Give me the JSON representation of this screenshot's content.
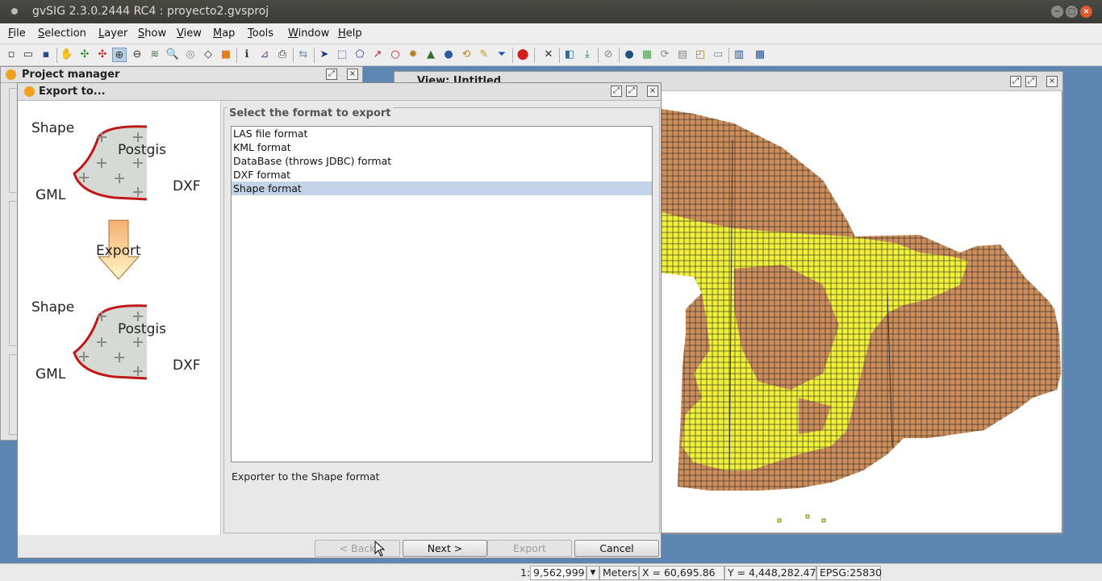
{
  "window": {
    "title": "gvSIG 2.3.0.2444 RC4 : proyecto2.gvsproj"
  },
  "menu": [
    "File",
    "Selection",
    "Layer",
    "Show",
    "View",
    "Map",
    "Tools",
    "Window",
    "Help"
  ],
  "project_manager": {
    "title": "Project manager"
  },
  "view_window": {
    "title": "View: Untitled"
  },
  "dialog": {
    "title": "Export to...",
    "illustration": {
      "top": {
        "shape": "Shape",
        "postgis": "Postgis",
        "gml": "GML",
        "dxf": "DXF"
      },
      "arrow_label": "Export",
      "bottom": {
        "shape": "Shape",
        "postgis": "Postgis",
        "gml": "GML",
        "dxf": "DXF"
      }
    },
    "group_title": "Select the format to export",
    "formats": [
      "LAS file format",
      "KML format",
      "DataBase (throws JDBC) format",
      "DXF format",
      "Shape format"
    ],
    "selected_format": "Shape format",
    "description": "Exporter to the Shape format",
    "buttons": {
      "back": "< Back",
      "next": "Next >",
      "export": "Export",
      "cancel": "Cancel"
    }
  },
  "status": {
    "scale_prefix": "1:",
    "scale": "9,562,999",
    "units": "Meters",
    "x": "X = 60,695.86",
    "y": "Y = 4,448,282.47",
    "crs": "EPSG:25830"
  },
  "colors": {
    "map_brown": "#cc8f5c",
    "map_yellow": "#f0f03a",
    "selection": "#c4d4e8",
    "desktop": "#5e86b2"
  },
  "toolbar_icons": [
    "new-icon",
    "open-icon",
    "save-icon",
    "pan-icon",
    "zoom-full-icon",
    "zoom-select-icon",
    "zoom-in-icon",
    "zoom-out-icon",
    "layers-icon",
    "zoom-layer-icon",
    "zoom-prev-icon",
    "zoom-next-icon",
    "locator-icon",
    "info-icon",
    "measure-icon",
    "print-icon",
    "hyperlink-icon",
    "select-icon",
    "select-rect-icon",
    "select-polygon-icon",
    "select-line-icon",
    "select-circle-icon",
    "select-buffer-icon",
    "select-area-icon",
    "globe-icon",
    "invert-selection-icon",
    "clear-selection-icon",
    "filter-icon",
    "stop-icon",
    "tools-icon",
    "edit-icon",
    "snap-icon",
    "graphic-icon",
    "world-icon",
    "raster-icon",
    "reload-icon",
    "cache-icon",
    "geoprocess-icon",
    "image-icon",
    "table-icon",
    "report-icon"
  ]
}
